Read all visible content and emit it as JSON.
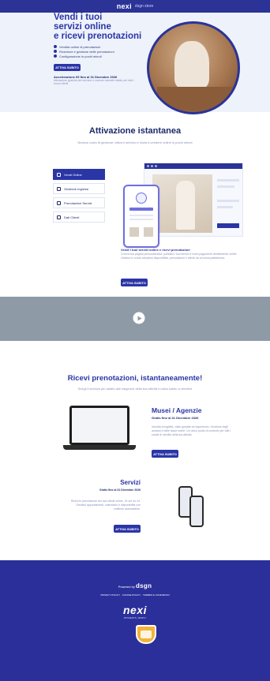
{
  "header": {
    "logo": "nexi",
    "partner": "dsgn store"
  },
  "hero": {
    "title_lines": [
      "Vendi i tuoi",
      "servizi online",
      "e ricevi prenotazioni"
    ],
    "bullets": [
      "Vendita online di prenotazioni",
      "Ricezione e gestione delle prenotazioni",
      "Configurazione in pochi minuti"
    ],
    "cta": "ATTIVA SUBITO",
    "note_title": "Accelerazione 69 fino al 31 Dicembre 2026",
    "note_text": "Attivazione gratuita del servizio e canone mensile ridotto per tutti i nuovi clienti"
  },
  "activation": {
    "title": "Attivazione istantanea",
    "subtitle": "Nessun costo di gestione: attiva il servizio e inizia a vendere online in pochi minuti",
    "menu": [
      {
        "label": "Vendi Online",
        "active": true
      },
      {
        "label": "Gestione Ingressi",
        "active": false
      },
      {
        "label": "Prenotazioni Servizi",
        "active": false
      },
      {
        "label": "Dati Clienti",
        "active": false
      }
    ],
    "caption_title": "Vendi i tuoi servizi online e ricevi prenotazioni",
    "caption_text": "Crea la tua pagina personalizzata, pubblica i tuoi servizi e ricevi pagamenti direttamente online. Gestisci in modo semplice disponibilità, prenotazioni e clienti da un'unica piattaforma.",
    "cta": "ATTIVA SUBITO"
  },
  "video": {
    "play_icon": "play-icon"
  },
  "bookings": {
    "title": "Ricevi prenotazioni, istantaneamente!",
    "subtitle": "Scegli il servizio più adatto alle esigenze della tua attività e inizia subito a vendere",
    "musei": {
      "title": "Musei / Agenzie",
      "subtitle": "Gratis fino al 31 Dicembre 2026",
      "text": "Vendita di biglietti, visite guidate ed esperienze. Gestione degli accessi e delle fasce orarie. Un unico punto di controllo per tutti i canali di vendita della tua attività.",
      "cta": "ATTIVA SUBITO"
    },
    "servizi": {
      "title": "Servizi",
      "subtitle": "Gratis fino al 31 Dicembre 2026",
      "text": "Ricevi le prenotazioni dei tuoi clienti online, 24 ore su 24. Gestisci appuntamenti, calendario e disponibilità con notifiche automatiche.",
      "cta": "ATTIVA SUBITO"
    }
  },
  "footer": {
    "powered_by": "Powered by",
    "brand": "dsgn",
    "links": "PRIVACY POLICY · COOKIE POLICY · TERMINI E CONDIZIONI",
    "logo": "nexi",
    "tag": "PAYMENTS, SIMPLY"
  }
}
